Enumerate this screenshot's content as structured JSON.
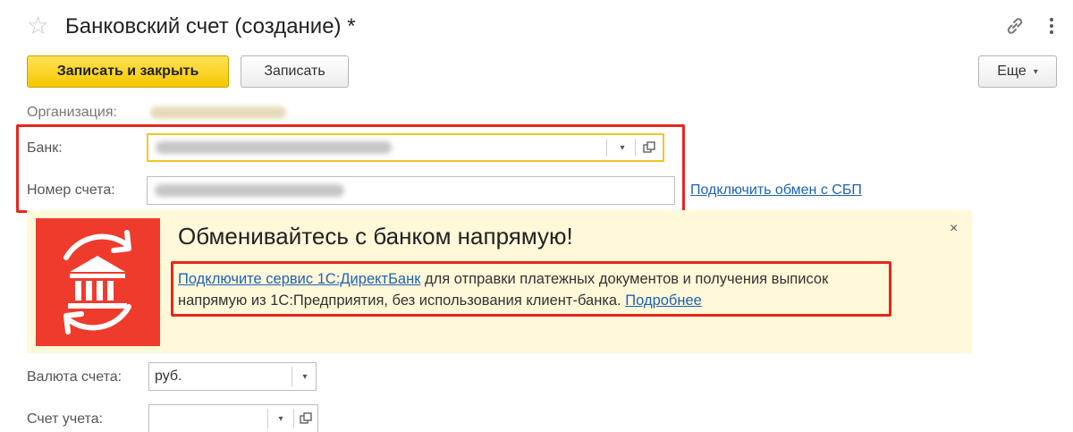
{
  "window": {
    "title": "Банковский счет (создание) *",
    "icons": [
      "star-icon",
      "link-icon",
      "more-vertical-icon"
    ]
  },
  "toolbar": {
    "save_close_label": "Записать и закрыть",
    "save_label": "Записать",
    "more_label": "Еще"
  },
  "form": {
    "organization_label": "Организация:",
    "bank_label": "Банк:",
    "account_number_label": "Номер счета:",
    "sbp_link": "Подключить обмен с СБП",
    "currency_label": "Валюта счета:",
    "currency_value": "руб.",
    "ledger_account_label": "Счет учета:"
  },
  "banner": {
    "title": "Обменивайтесь с банком напрямую!",
    "link_text": "Подключите сервис 1С:ДиректБанк",
    "body_text": " для отправки платежных документов и получения выписок напрямую из 1С:Предприятия, без использования клиент-банка. ",
    "more_link": "Подробнее",
    "close_label": "×",
    "icon": "bank-exchange-icon"
  },
  "colors": {
    "primary_button": "#f5c800",
    "highlight_border": "#e8261c",
    "link": "#1e63b7",
    "banner_bg": "#fff8d9",
    "banner_logo_bg": "#ef3b2c",
    "focus_border": "#f3c623"
  }
}
